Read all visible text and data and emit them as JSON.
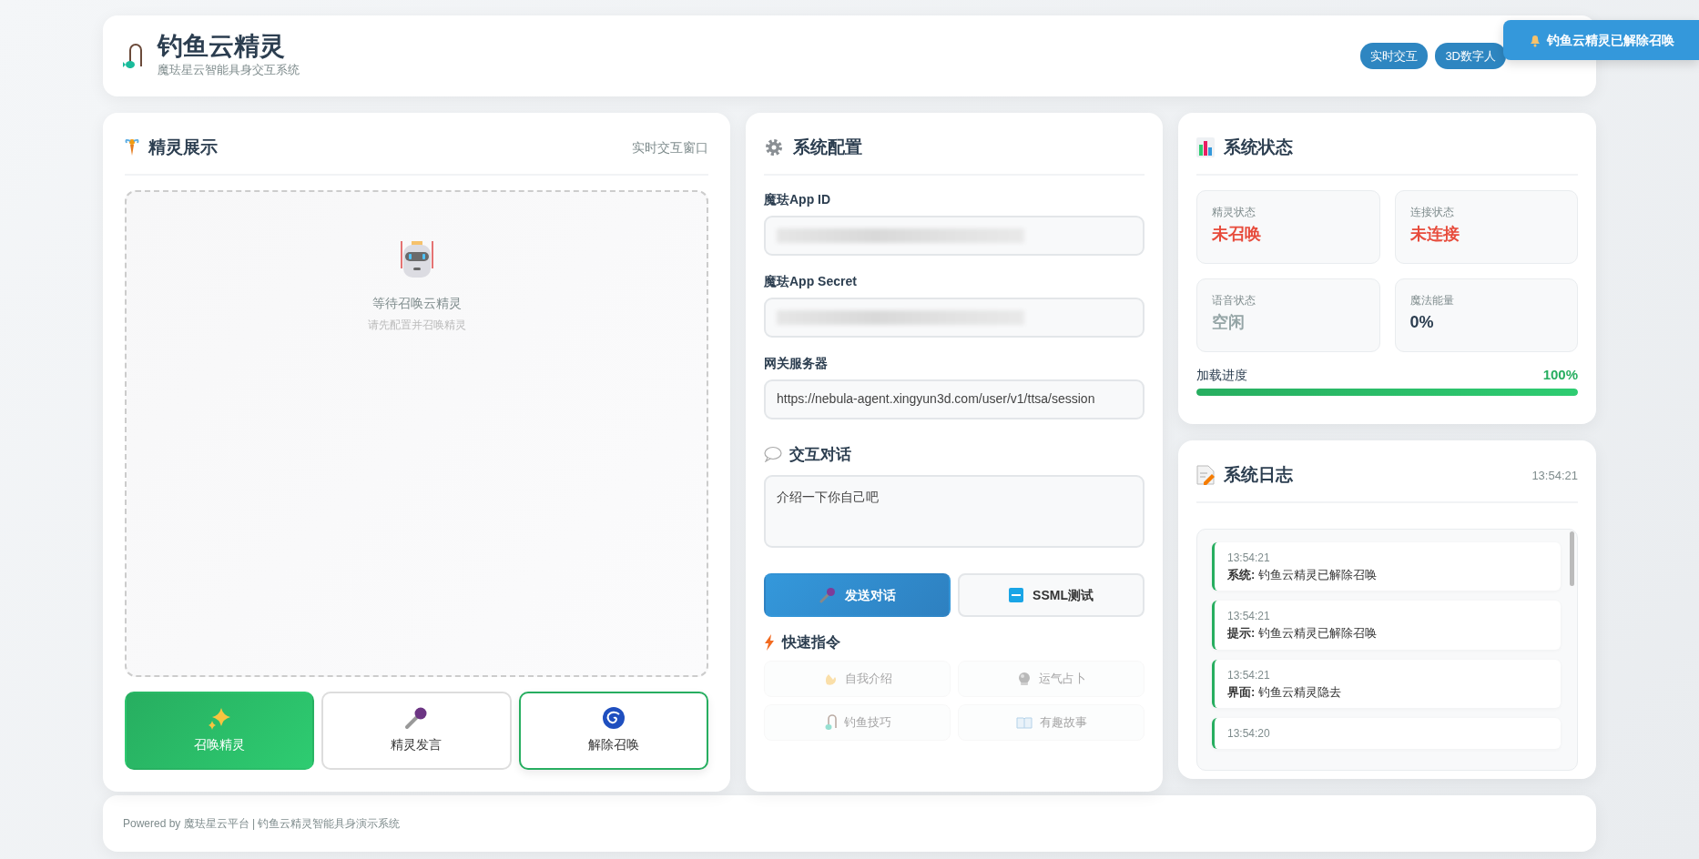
{
  "header": {
    "title": "钓鱼云精灵",
    "subtitle": "魔珐星云智能具身交互系统",
    "badges": [
      "实时交互",
      "3D数字人"
    ]
  },
  "toast": {
    "text": "钓鱼云精灵已解除召唤"
  },
  "stage": {
    "title": "精灵展示",
    "hint": "实时交互窗口",
    "placeholder_title": "等待召唤云精灵",
    "placeholder_sub": "请先配置并召唤精灵",
    "actions": [
      {
        "kind": "summon",
        "label": "召唤精灵",
        "selected": false
      },
      {
        "kind": "speak",
        "label": "精灵发言",
        "selected": false
      },
      {
        "kind": "dismiss",
        "label": "解除召唤",
        "selected": true
      }
    ]
  },
  "config": {
    "title": "系统配置",
    "fields": [
      {
        "label": "魔珐App ID",
        "kind": "masked"
      },
      {
        "label": "魔珐App Secret",
        "kind": "masked"
      },
      {
        "label": "网关服务器",
        "kind": "text",
        "value": "https://nebula-agent.xingyun3d.com/user/v1/ttsa/session"
      }
    ]
  },
  "dialog": {
    "title": "交互对话",
    "value": "介绍一下你自己吧",
    "buttons": [
      {
        "kind": "send",
        "label": "发送对话"
      },
      {
        "kind": "ssml",
        "label": "SSML测试"
      }
    ]
  },
  "quick": {
    "title": "快速指令",
    "commands": [
      {
        "kind": "wave",
        "label": "自我介绍",
        "disabled": true
      },
      {
        "kind": "ball",
        "label": "运气占卜",
        "disabled": true
      },
      {
        "kind": "hook",
        "label": "钓鱼技巧",
        "disabled": true
      },
      {
        "kind": "book",
        "label": "有趣故事",
        "disabled": true
      }
    ]
  },
  "status": {
    "title": "系统状态",
    "tiles": [
      {
        "label": "精灵状态",
        "value": "未召唤",
        "color": "#e74c3c"
      },
      {
        "label": "连接状态",
        "value": "未连接",
        "color": "#e74c3c"
      },
      {
        "label": "语音状态",
        "value": "空闲",
        "color": "#95a5a6"
      },
      {
        "label": "魔法能量",
        "value": "0%",
        "color": "#2c3e50"
      }
    ],
    "progress": {
      "label": "加载进度",
      "reading": "100%",
      "level": 1
    }
  },
  "log": {
    "title": "系统日志",
    "time": "13:54:21",
    "entries": [
      {
        "time": "13:54:21",
        "source": "系统:",
        "message": "钓鱼云精灵已解除召唤"
      },
      {
        "time": "13:54:21",
        "source": "提示:",
        "message": "钓鱼云精灵已解除召唤"
      },
      {
        "time": "13:54:21",
        "source": "界面:",
        "message": "钓鱼云精灵隐去"
      },
      {
        "time": "13:54:20"
      }
    ]
  },
  "footer": {
    "text": "Powered by 魔珐星云平台 | 钓鱼云精灵智能具身演示系统"
  }
}
